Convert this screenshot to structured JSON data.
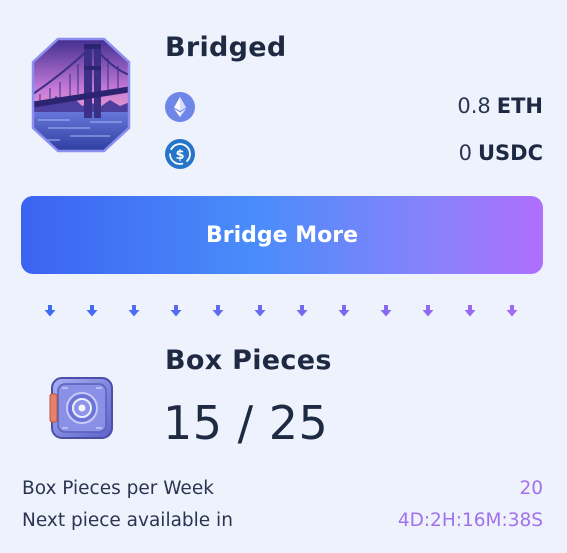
{
  "bridged": {
    "title": "Bridged",
    "tokens": [
      {
        "amount": "0.8",
        "symbol": "ETH",
        "icon": "ethereum-icon",
        "icon_color": "#6e86e8"
      },
      {
        "amount": "0",
        "symbol": "USDC",
        "icon": "usdc-icon",
        "icon_color": "#2775ca"
      }
    ]
  },
  "button": {
    "label": "Bridge More"
  },
  "arrows": {
    "count": 12,
    "start_color": "#3c6cf0",
    "end_color": "#a268f0"
  },
  "box_pieces": {
    "title": "Box Pieces",
    "count": "15 / 25",
    "current": 15,
    "total": 25
  },
  "stats": [
    {
      "label": "Box Pieces per Week",
      "value": "20"
    },
    {
      "label": "Next piece available in",
      "value": "4D:2H:16M:38S"
    }
  ],
  "colors": {
    "background": "#eef2fd",
    "text": "#1e2a42",
    "accent_purple": "#a272ec",
    "button_gradient": [
      "#3c63f2",
      "#4a8cfa",
      "#b06ffc"
    ]
  }
}
